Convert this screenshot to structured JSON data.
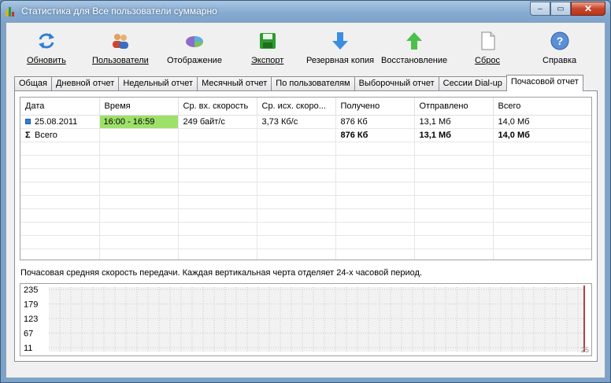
{
  "window": {
    "title": "Статистика для Все пользователи суммарно",
    "minimize_glyph": "–",
    "maximize_glyph": "▭",
    "close_glyph": "✕"
  },
  "toolbar": {
    "items": [
      {
        "label": "Обновить",
        "icon": "refresh-icon"
      },
      {
        "label": "Пользователи",
        "icon": "users-icon"
      },
      {
        "label": "Отображение",
        "icon": "display-icon"
      },
      {
        "label": "Экспорт",
        "icon": "export-icon"
      },
      {
        "label": "Резервная копия",
        "icon": "backup-icon"
      },
      {
        "label": "Восстановление",
        "icon": "restore-icon"
      },
      {
        "label": "Сброс",
        "icon": "reset-icon"
      },
      {
        "label": "Справка",
        "icon": "help-icon"
      }
    ]
  },
  "tabs": [
    {
      "label": "Общая"
    },
    {
      "label": "Дневной отчет"
    },
    {
      "label": "Недельный отчет"
    },
    {
      "label": "Месячный отчет"
    },
    {
      "label": "По пользователям"
    },
    {
      "label": "Выборочный отчет"
    },
    {
      "label": "Сессии Dial-up"
    },
    {
      "label": "Почасовой отчет"
    }
  ],
  "active_tab": "Почасовой отчет",
  "table": {
    "columns": [
      "Дата",
      "Время",
      "Ср. вх. скорость",
      "Ср. исх. скоро...",
      "Получено",
      "Отправлено",
      "Всего"
    ],
    "rows": [
      {
        "date": "25.08.2011",
        "time": "16:00 - 16:59",
        "avg_in": "249 байт/с",
        "avg_out": "3,73 Кб/с",
        "received": "876 Кб",
        "sent": "13,1 Мб",
        "total": "14,0 Мб"
      }
    ],
    "total_row": {
      "label": "Всего",
      "sigma": "Σ",
      "received": "876 Кб",
      "sent": "13,1 Мб",
      "total": "14,0 Мб"
    }
  },
  "chart_caption": "Почасовая средняя скорость передачи. Каждая вертикальная черта отделяет 24-х часовой период.",
  "chart_data": {
    "type": "bar",
    "y_ticks": [
      "235",
      "179",
      "123",
      "67",
      "11"
    ],
    "ylim": [
      11,
      235
    ],
    "x_tick_label": "25",
    "grid": true,
    "series_color": "#a00000",
    "day_separator_color": "#a00000",
    "values": []
  },
  "colors": {
    "time_highlight": "#9ee16a",
    "close_button": "#c9452a"
  }
}
